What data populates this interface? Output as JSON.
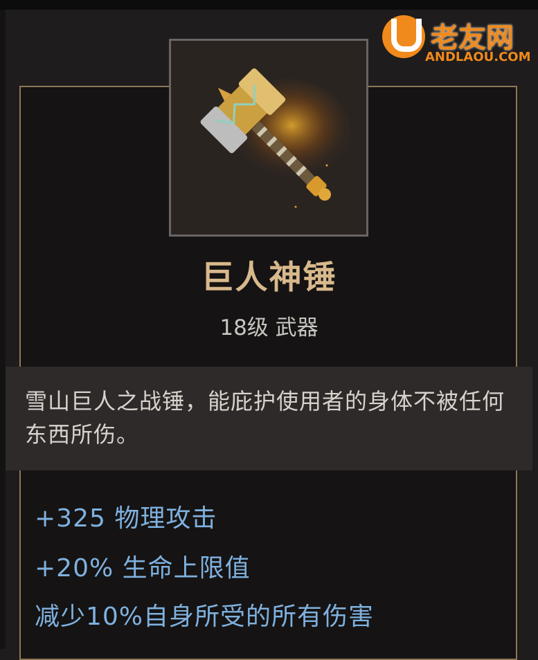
{
  "item": {
    "name": "巨人神锤",
    "meta": "18级 武器",
    "icon": "hammer-icon",
    "description": "雪山巨人之战锤，能庇护使用者的身体不被任何东西所伤。",
    "stats": [
      "+325 物理攻击",
      "+20% 生命上限值",
      "减少10%自身所受的所有伤害"
    ]
  },
  "watermark": {
    "name": "老友网",
    "url": "ANDLAOU.COM"
  },
  "colors": {
    "name": "#d8b98c",
    "stat": "#7fb1df",
    "border": "#8e7756",
    "brand": "#f08a1c"
  }
}
